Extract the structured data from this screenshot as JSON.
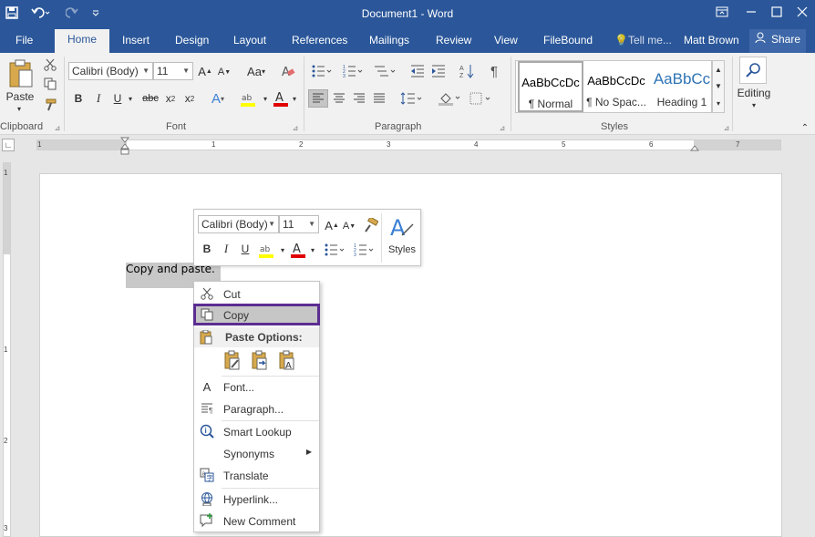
{
  "window": {
    "title": "Document1 - Word",
    "colors": {
      "accent": "#2b579a",
      "selection_outline": "#5c2d91",
      "ribbon_bg": "#f1f1f1"
    }
  },
  "quick_access": {
    "save_icon": "save-icon",
    "undo_icon": "undo-icon",
    "redo_icon": "redo-icon",
    "customize_icon": "customize-icon"
  },
  "tabs": [
    "File",
    "Home",
    "Insert",
    "Design",
    "Layout",
    "References",
    "Mailings",
    "Review",
    "View",
    "FileBound"
  ],
  "tell_me": "Tell me...",
  "user": {
    "name": "Matt Brown",
    "share": "Share"
  },
  "ribbon": {
    "clipboard": {
      "paste_label": "Paste",
      "group_label": "Clipboard"
    },
    "font": {
      "font_name": "Calibri (Body)",
      "font_size": "11",
      "case_label": "Aa",
      "group_label": "Font"
    },
    "paragraph": {
      "group_label": "Paragraph"
    },
    "styles": {
      "group_label": "Styles",
      "items": [
        {
          "sample": "AaBbCcDc",
          "name": "¶ Normal"
        },
        {
          "sample": "AaBbCcDc",
          "name": "¶ No Spac..."
        },
        {
          "sample": "AaBbCc",
          "name": "Heading 1"
        }
      ]
    },
    "editing": {
      "label": "Editing"
    }
  },
  "ruler": {
    "numbers": [
      "1",
      "1",
      "2",
      "3",
      "4",
      "5",
      "6",
      "7"
    ],
    "vnumbers": [
      "1",
      "1",
      "2",
      "3"
    ]
  },
  "document": {
    "text": "Copy and paste."
  },
  "mini_toolbar": {
    "font_name": "Calibri (Body)",
    "font_size": "11",
    "styles_label": "Styles"
  },
  "context_menu": {
    "items": [
      {
        "label": "Cut",
        "icon": "scissors-icon"
      },
      {
        "label": "Copy",
        "icon": "copy-icon",
        "selected": true
      },
      {
        "label": "Font...",
        "icon": "font-icon"
      },
      {
        "label": "Paragraph...",
        "icon": "paragraph-icon"
      },
      {
        "label": "Smart Lookup",
        "icon": "smart-lookup-icon"
      },
      {
        "label": "Synonyms",
        "icon": "synonyms-icon",
        "submenu": true
      },
      {
        "label": "Translate",
        "icon": "translate-icon"
      },
      {
        "label": "Hyperlink...",
        "icon": "hyperlink-icon"
      },
      {
        "label": "New Comment",
        "icon": "new-comment-icon"
      }
    ],
    "paste_options_label": "Paste Options:"
  }
}
